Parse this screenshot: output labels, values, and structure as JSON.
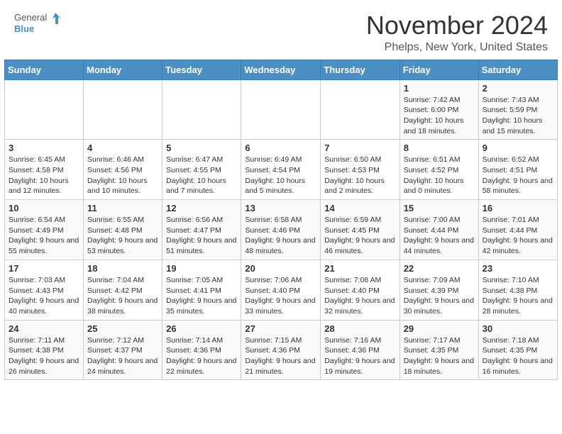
{
  "logo": {
    "text_general": "General",
    "text_blue": "Blue"
  },
  "header": {
    "title": "November 2024",
    "subtitle": "Phelps, New York, United States"
  },
  "weekdays": [
    "Sunday",
    "Monday",
    "Tuesday",
    "Wednesday",
    "Thursday",
    "Friday",
    "Saturday"
  ],
  "weeks": [
    [
      {
        "day": "",
        "content": ""
      },
      {
        "day": "",
        "content": ""
      },
      {
        "day": "",
        "content": ""
      },
      {
        "day": "",
        "content": ""
      },
      {
        "day": "",
        "content": ""
      },
      {
        "day": "1",
        "content": "Sunrise: 7:42 AM\nSunset: 6:00 PM\nDaylight: 10 hours and 18 minutes."
      },
      {
        "day": "2",
        "content": "Sunrise: 7:43 AM\nSunset: 5:59 PM\nDaylight: 10 hours and 15 minutes."
      }
    ],
    [
      {
        "day": "3",
        "content": "Sunrise: 6:45 AM\nSunset: 4:58 PM\nDaylight: 10 hours and 12 minutes."
      },
      {
        "day": "4",
        "content": "Sunrise: 6:46 AM\nSunset: 4:56 PM\nDaylight: 10 hours and 10 minutes."
      },
      {
        "day": "5",
        "content": "Sunrise: 6:47 AM\nSunset: 4:55 PM\nDaylight: 10 hours and 7 minutes."
      },
      {
        "day": "6",
        "content": "Sunrise: 6:49 AM\nSunset: 4:54 PM\nDaylight: 10 hours and 5 minutes."
      },
      {
        "day": "7",
        "content": "Sunrise: 6:50 AM\nSunset: 4:53 PM\nDaylight: 10 hours and 2 minutes."
      },
      {
        "day": "8",
        "content": "Sunrise: 6:51 AM\nSunset: 4:52 PM\nDaylight: 10 hours and 0 minutes."
      },
      {
        "day": "9",
        "content": "Sunrise: 6:52 AM\nSunset: 4:51 PM\nDaylight: 9 hours and 58 minutes."
      }
    ],
    [
      {
        "day": "10",
        "content": "Sunrise: 6:54 AM\nSunset: 4:49 PM\nDaylight: 9 hours and 55 minutes."
      },
      {
        "day": "11",
        "content": "Sunrise: 6:55 AM\nSunset: 4:48 PM\nDaylight: 9 hours and 53 minutes."
      },
      {
        "day": "12",
        "content": "Sunrise: 6:56 AM\nSunset: 4:47 PM\nDaylight: 9 hours and 51 minutes."
      },
      {
        "day": "13",
        "content": "Sunrise: 6:58 AM\nSunset: 4:46 PM\nDaylight: 9 hours and 48 minutes."
      },
      {
        "day": "14",
        "content": "Sunrise: 6:59 AM\nSunset: 4:45 PM\nDaylight: 9 hours and 46 minutes."
      },
      {
        "day": "15",
        "content": "Sunrise: 7:00 AM\nSunset: 4:44 PM\nDaylight: 9 hours and 44 minutes."
      },
      {
        "day": "16",
        "content": "Sunrise: 7:01 AM\nSunset: 4:44 PM\nDaylight: 9 hours and 42 minutes."
      }
    ],
    [
      {
        "day": "17",
        "content": "Sunrise: 7:03 AM\nSunset: 4:43 PM\nDaylight: 9 hours and 40 minutes."
      },
      {
        "day": "18",
        "content": "Sunrise: 7:04 AM\nSunset: 4:42 PM\nDaylight: 9 hours and 38 minutes."
      },
      {
        "day": "19",
        "content": "Sunrise: 7:05 AM\nSunset: 4:41 PM\nDaylight: 9 hours and 35 minutes."
      },
      {
        "day": "20",
        "content": "Sunrise: 7:06 AM\nSunset: 4:40 PM\nDaylight: 9 hours and 33 minutes."
      },
      {
        "day": "21",
        "content": "Sunrise: 7:08 AM\nSunset: 4:40 PM\nDaylight: 9 hours and 32 minutes."
      },
      {
        "day": "22",
        "content": "Sunrise: 7:09 AM\nSunset: 4:39 PM\nDaylight: 9 hours and 30 minutes."
      },
      {
        "day": "23",
        "content": "Sunrise: 7:10 AM\nSunset: 4:38 PM\nDaylight: 9 hours and 28 minutes."
      }
    ],
    [
      {
        "day": "24",
        "content": "Sunrise: 7:11 AM\nSunset: 4:38 PM\nDaylight: 9 hours and 26 minutes."
      },
      {
        "day": "25",
        "content": "Sunrise: 7:12 AM\nSunset: 4:37 PM\nDaylight: 9 hours and 24 minutes."
      },
      {
        "day": "26",
        "content": "Sunrise: 7:14 AM\nSunset: 4:36 PM\nDaylight: 9 hours and 22 minutes."
      },
      {
        "day": "27",
        "content": "Sunrise: 7:15 AM\nSunset: 4:36 PM\nDaylight: 9 hours and 21 minutes."
      },
      {
        "day": "28",
        "content": "Sunrise: 7:16 AM\nSunset: 4:36 PM\nDaylight: 9 hours and 19 minutes."
      },
      {
        "day": "29",
        "content": "Sunrise: 7:17 AM\nSunset: 4:35 PM\nDaylight: 9 hours and 18 minutes."
      },
      {
        "day": "30",
        "content": "Sunrise: 7:18 AM\nSunset: 4:35 PM\nDaylight: 9 hours and 16 minutes."
      }
    ]
  ]
}
